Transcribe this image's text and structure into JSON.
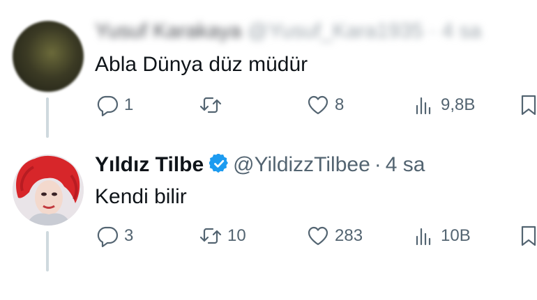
{
  "tweets": [
    {
      "author_name": "Yusuf Karakaya",
      "author_meta": "@Yusuf_Kara1935 · 4 sa",
      "text": "Abla Dünya düz müdür",
      "reply_count": "1",
      "retweet_count": "",
      "like_count": "8",
      "view_count": "9,8B"
    },
    {
      "author_name": "Yıldız Tilbe",
      "handle": "@YildizzTilbee",
      "separator": "·",
      "time": "4 sa",
      "verified": true,
      "text": "Kendi bilir",
      "reply_count": "3",
      "retweet_count": "10",
      "like_count": "283",
      "view_count": "10B"
    }
  ],
  "colors": {
    "verified_badge": "#1d9bf0",
    "muted_text": "#536471",
    "thread_line": "#cfd9de"
  },
  "icons": [
    "reply-icon",
    "retweet-icon",
    "like-icon",
    "views-icon",
    "bookmark-icon",
    "verified-badge-icon"
  ]
}
